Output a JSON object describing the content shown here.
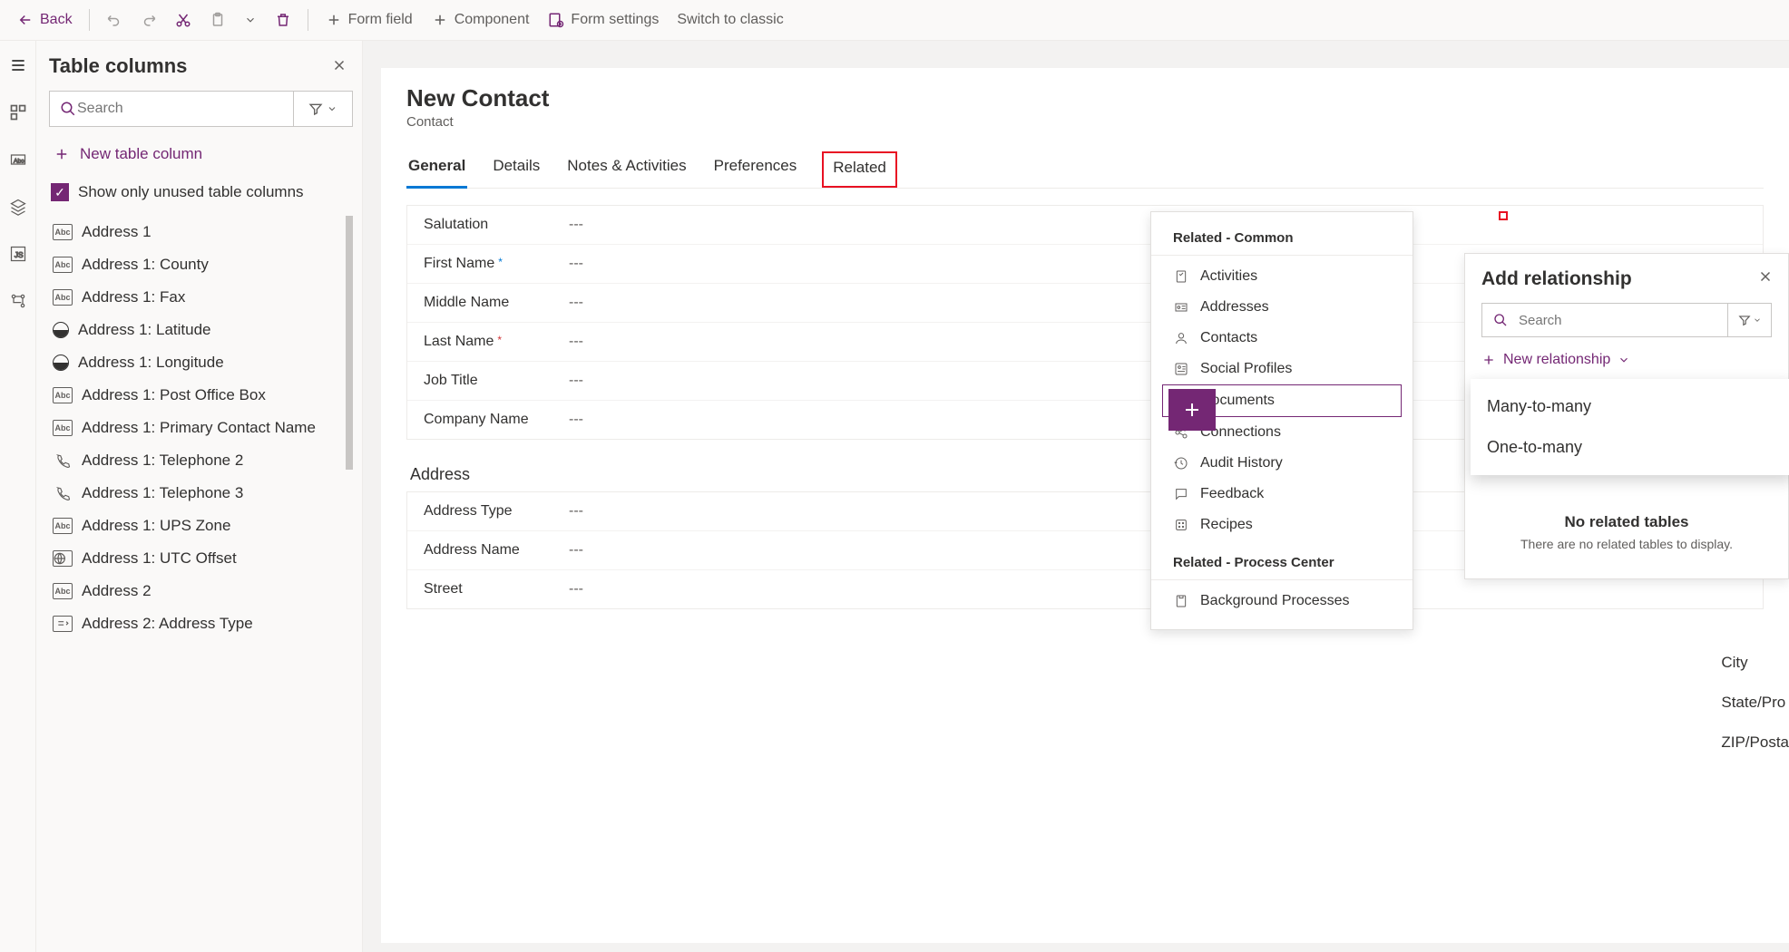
{
  "toolbar": {
    "back": "Back",
    "form_field": "Form field",
    "component": "Component",
    "form_settings": "Form settings",
    "switch": "Switch to classic"
  },
  "sidepanel": {
    "title": "Table columns",
    "search_placeholder": "Search",
    "new_column": "New table column",
    "show_unused": "Show only unused table columns",
    "columns": [
      {
        "icon": "abc",
        "label": "Address 1"
      },
      {
        "icon": "abc",
        "label": "Address 1: County"
      },
      {
        "icon": "abc",
        "label": "Address 1: Fax"
      },
      {
        "icon": "lat",
        "label": "Address 1: Latitude"
      },
      {
        "icon": "lat",
        "label": "Address 1: Longitude"
      },
      {
        "icon": "abc",
        "label": "Address 1: Post Office Box"
      },
      {
        "icon": "abc",
        "label": "Address 1: Primary Contact Name"
      },
      {
        "icon": "phone",
        "label": "Address 1: Telephone 2"
      },
      {
        "icon": "phone",
        "label": "Address 1: Telephone 3"
      },
      {
        "icon": "abc",
        "label": "Address 1: UPS Zone"
      },
      {
        "icon": "utc",
        "label": "Address 1: UTC Offset"
      },
      {
        "icon": "abc",
        "label": "Address 2"
      },
      {
        "icon": "select",
        "label": "Address 2: Address Type"
      }
    ]
  },
  "form": {
    "title": "New Contact",
    "subtitle": "Contact",
    "tabs": [
      "General",
      "Details",
      "Notes & Activities",
      "Preferences",
      "Related"
    ],
    "fields1": [
      {
        "label": "Salutation",
        "req": "",
        "val": "---"
      },
      {
        "label": "First Name",
        "req": "blue",
        "val": "---"
      },
      {
        "label": "Middle Name",
        "req": "",
        "val": "---"
      },
      {
        "label": "Last Name",
        "req": "red",
        "val": "---"
      },
      {
        "label": "Job Title",
        "req": "",
        "val": "---"
      },
      {
        "label": "Company Name",
        "req": "",
        "val": "---"
      }
    ],
    "section2": "Address",
    "fields2": [
      {
        "label": "Address Type",
        "val": "---"
      },
      {
        "label": "Address Name",
        "val": "---"
      },
      {
        "label": "Street",
        "val": "---"
      }
    ],
    "rightlabels": [
      "City",
      "State/Pro",
      "ZIP/Posta"
    ]
  },
  "related_menu": {
    "hdr1": "Related - Common",
    "items1": [
      "Activities",
      "Addresses",
      "Contacts",
      "Social Profiles",
      "Documents",
      "Connections",
      "Audit History",
      "Feedback",
      "Recipes"
    ],
    "selected": "Documents",
    "hdr2": "Related - Process Center",
    "items2": [
      "Background Processes"
    ]
  },
  "relpanel": {
    "title": "Add relationship",
    "search_placeholder": "Search",
    "new_rel": "New relationship",
    "options": [
      "Many-to-many",
      "One-to-many"
    ],
    "empty_t": "No related tables",
    "empty_s": "There are no related tables to display."
  }
}
